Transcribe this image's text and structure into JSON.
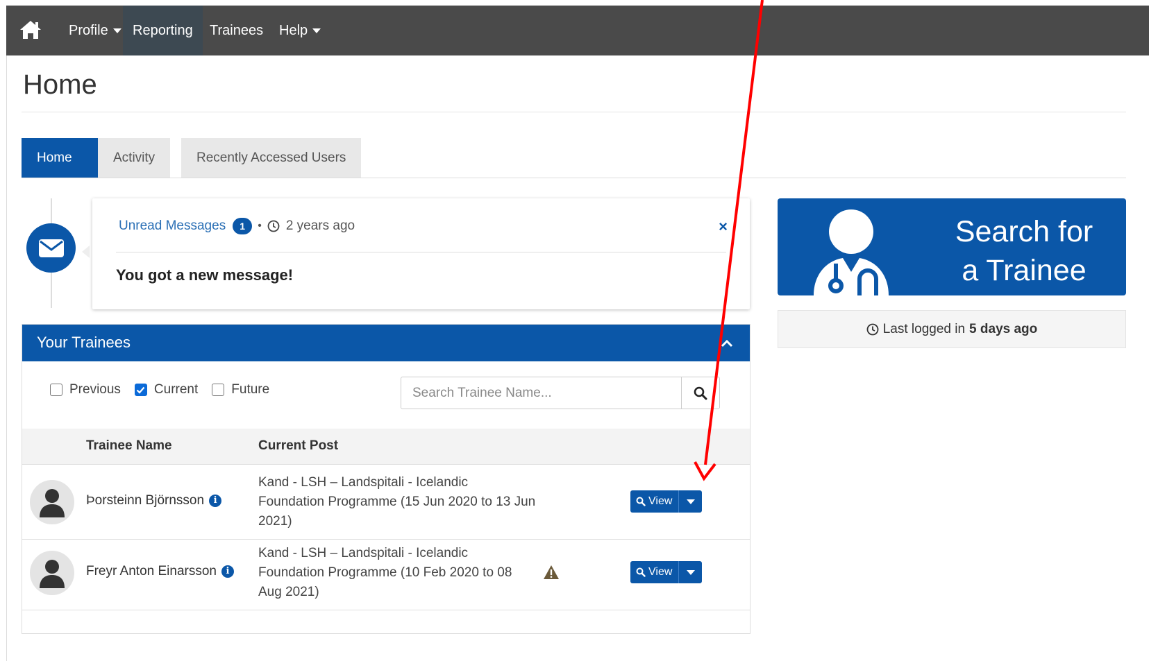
{
  "nav": {
    "home_icon": "home-icon",
    "items": [
      {
        "label": "Profile",
        "has_caret": true
      },
      {
        "label": "Reporting",
        "active": true
      },
      {
        "label": "Trainees"
      },
      {
        "label": "Help",
        "has_caret": true
      }
    ]
  },
  "page": {
    "title": "Home"
  },
  "tabs": [
    {
      "label": "Home",
      "active": true
    },
    {
      "label": "Activity"
    },
    {
      "label": "Recently Accessed Users"
    }
  ],
  "message": {
    "link": "Unread Messages",
    "count": "1",
    "separator": "•",
    "time": "2 years ago",
    "close": "×",
    "body": "You got a new message!"
  },
  "trainees_panel": {
    "title": "Your Trainees",
    "filters": [
      {
        "label": "Previous",
        "checked": false
      },
      {
        "label": "Current",
        "checked": true
      },
      {
        "label": "Future",
        "checked": false
      }
    ],
    "search_placeholder": "Search Trainee Name...",
    "columns": {
      "name": "Trainee Name",
      "post": "Current Post"
    },
    "rows": [
      {
        "name": "Þorsteinn Björnsson",
        "post": "Kand - LSH – Landspitali - Icelandic Foundation Programme (15 Jun 2020 to 13 Jun 2021)",
        "warning": false,
        "action": "View"
      },
      {
        "name": "Freyr Anton Einarsson",
        "post": "Kand - LSH – Landspitali - Icelandic Foundation Programme (10 Feb 2020 to 08 Aug 2021)",
        "warning": true,
        "action": "View"
      }
    ]
  },
  "search_card": {
    "line1": "Search for",
    "line2": "a Trainee"
  },
  "last_login": {
    "prefix": "Last logged in",
    "value": "5 days ago"
  },
  "colors": {
    "brand": "#0b57a8",
    "navbar": "#4a4a4a",
    "annotation": "#ff0000",
    "warning": "#6b5a3a"
  }
}
